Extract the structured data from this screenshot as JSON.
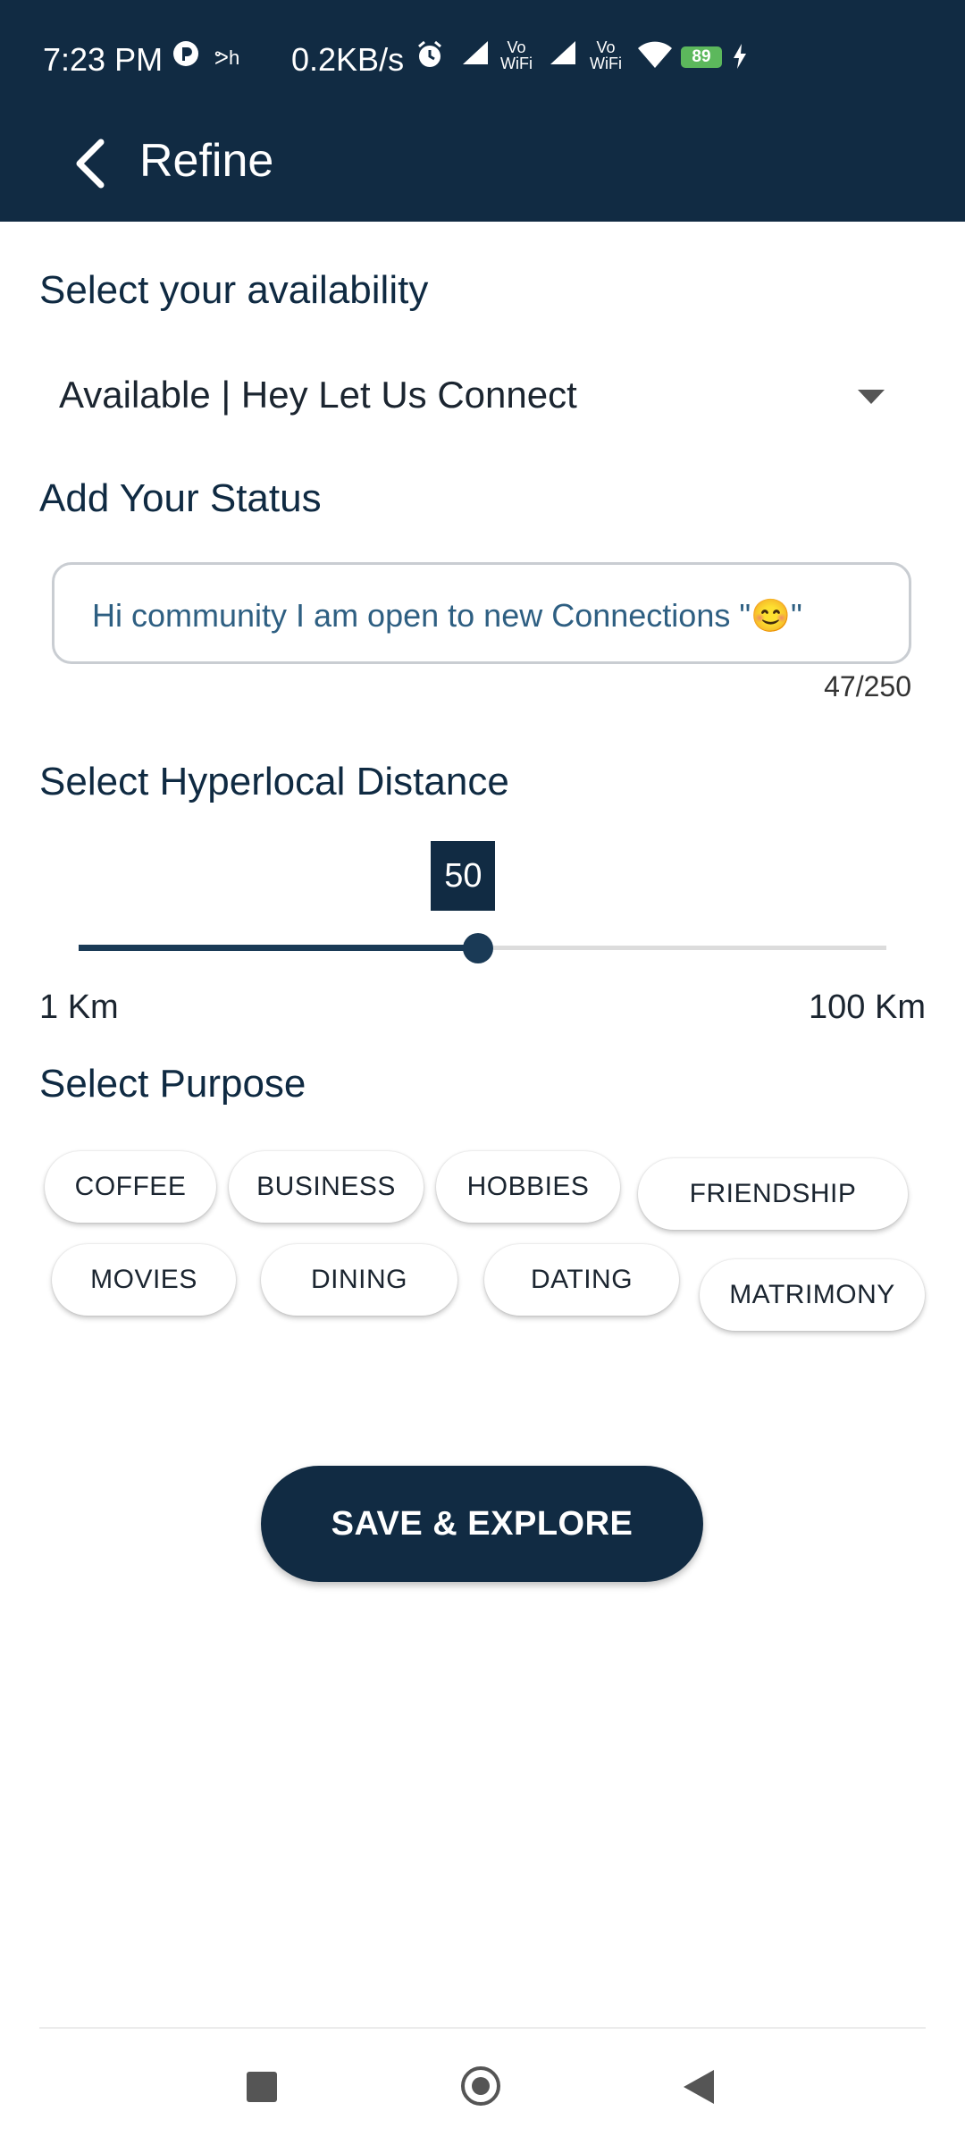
{
  "status_bar": {
    "time": "7:23 PM",
    "speed": "0.2KB/s",
    "battery": "89",
    "icons": [
      "app-notification-icon",
      "network-icon",
      "alarm-icon",
      "signal-icon",
      "vowifi-icon",
      "signal-icon",
      "vowifi-icon",
      "wifi-icon",
      "battery-icon",
      "charging-icon"
    ]
  },
  "header": {
    "title": "Refine",
    "back_icon": "chevron-left-icon"
  },
  "availability": {
    "label": "Select your availability",
    "selected": "Available | Hey Let Us Connect"
  },
  "status": {
    "label": "Add Your Status",
    "value": "Hi community I am open to new Connections  \"😊\"",
    "counter": "47/250"
  },
  "distance": {
    "label": "Select Hyperlocal Distance",
    "value": 50,
    "value_label": "50",
    "min_label": "1 Km",
    "max_label": "100 Km",
    "min": 1,
    "max": 100
  },
  "purpose": {
    "label": "Select Purpose",
    "chips": [
      "COFFEE",
      "BUSINESS",
      "HOBBIES",
      "FRIENDSHIP",
      "MOVIES",
      "DINING",
      "DATING",
      "MATRIMONY"
    ]
  },
  "actions": {
    "save_label": "SAVE & EXPLORE"
  },
  "colors": {
    "primary": "#112b43",
    "accent_text": "#2e5f82",
    "battery": "#5cb85c"
  }
}
